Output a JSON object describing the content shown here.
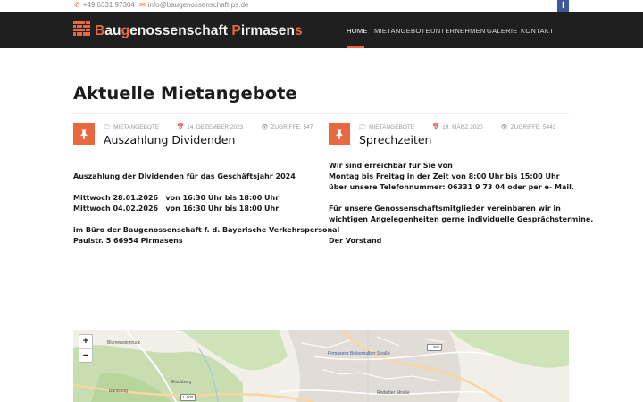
{
  "topbar": {
    "phone": "+49 6331 97304",
    "email": "info@baugenossenschaft-ps.de",
    "facebook_icon": "f"
  },
  "logo": {
    "parts": [
      {
        "text": "B",
        "accent": true
      },
      {
        "text": "au",
        "accent": false
      },
      {
        "text": "g",
        "accent": true
      },
      {
        "text": "enossenschaft ",
        "accent": false
      },
      {
        "text": "P",
        "accent": true
      },
      {
        "text": "irmasen",
        "accent": false
      },
      {
        "text": "s",
        "accent": true
      }
    ]
  },
  "nav": {
    "items": [
      "HOME",
      "MIETANGEBOTE",
      "UNTERNEHMEN",
      "GALERIE",
      "KONTAKT"
    ],
    "active": "HOME"
  },
  "page": {
    "title": "Aktuelle Mietangebote"
  },
  "posts": [
    {
      "category": "MIETANGEBOTE",
      "date": "14. DEZEMBER 2023",
      "views": "ZUGRIFFE: 547",
      "title": "Auszahlung Dividenden",
      "body": "Auszahlung der Dividenden für das Geschäftsjahr 2024\n\nMittwoch 28.01.2026   von 16:30 Uhr bis 18:00 Uhr\nMittwoch 04.02.2026   von 16:30 Uhr bis 18:00 Uhr\n\nim Büro der Baugenossenschaft f. d. Bayerische Verkehrspersonal\nPaulstr. 5 66954 Pirmasens"
    },
    {
      "category": "MIETANGEBOTE",
      "date": "19. MÄRZ 2020",
      "views": "ZUGRIFFE: 5443",
      "title": "Sprechzeiten",
      "body": "Wir sind erreichbar für Sie von\nMontag bis Freitag in der Zeit von 8:00 Uhr bis 15:00 Uhr\nüber unsere Telefonnummer: 06331 9 73 04 oder per e- Mail.\n\nFür unsere Genossenschaftsmitglieder vereinbaren wir in\nwichtigen Angelegenheiten gerne individuelle Gesprächstermine.\n\nDer Vorstand"
    }
  ],
  "map": {
    "zoom_in": "+",
    "zoom_out": "−",
    "labels": [
      "Blumensteinruck",
      "Pirmasens Bieberhalber Straße",
      "Eischberg",
      "Buntsteig",
      "L 482",
      "L 600",
      "Rodalber Straße"
    ]
  },
  "colors": {
    "accent": "#e8683f",
    "header_bg": "#1f1f1f",
    "facebook": "#3b5998"
  }
}
